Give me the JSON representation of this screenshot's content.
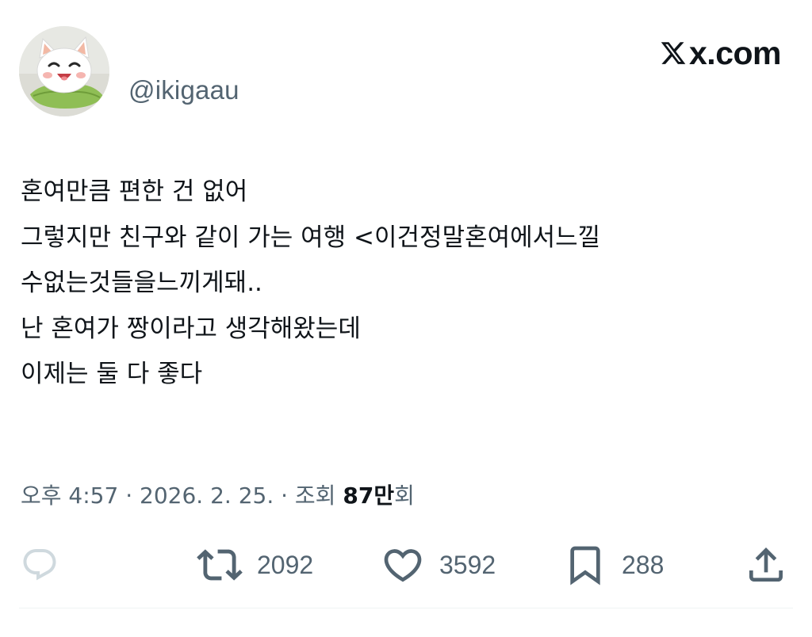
{
  "header": {
    "handle": "@ikigaau",
    "watermark": "x.com"
  },
  "tweet": {
    "lines": [
      "혼여만큼 편한 건 없어",
      "그렇지만 친구와 같이 가는 여행 <이건정말혼여에서느낄",
      "수없는것들을느끼게돼..",
      "난 혼여가 짱이라고 생각해왔는데",
      "이제는 둘 다 좋다"
    ]
  },
  "meta": {
    "time": "오후 4:57",
    "separator": " · ",
    "date": "2026. 2. 25.",
    "views_label": "조회",
    "views_number": "87만",
    "views_suffix": "회"
  },
  "actions": {
    "reply_icon": "reply-icon",
    "retweet_count": "2092",
    "like_count": "3592",
    "bookmark_count": "288",
    "share_icon": "share-icon"
  },
  "colors": {
    "text": "#0f1419",
    "secondary": "#536471",
    "reply_icon": "#cfd9de",
    "divider": "#eff3f4"
  }
}
